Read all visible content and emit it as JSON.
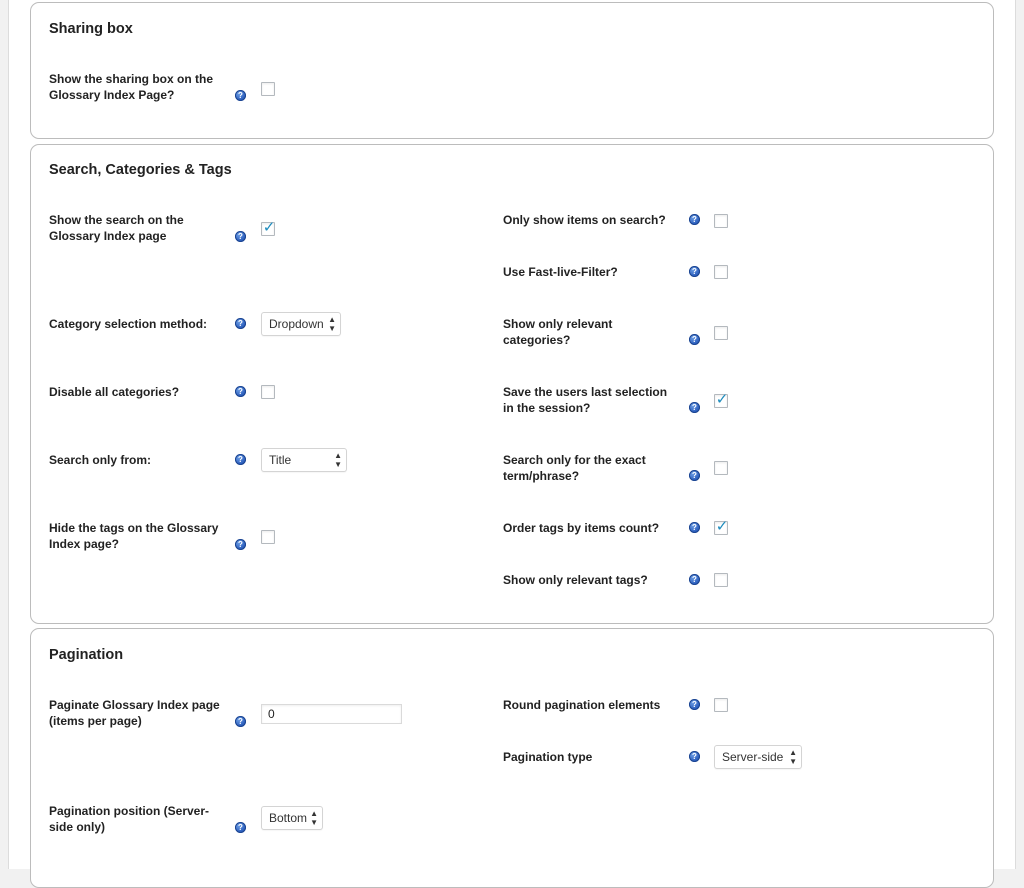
{
  "sharing_box": {
    "title": "Sharing box",
    "show_sharing_box": {
      "label_line1": "Show the sharing box on the",
      "label_line2": "Glossary Index Page?",
      "checked": false
    }
  },
  "search_section": {
    "title": "Search, Categories & Tags",
    "left": {
      "show_search": {
        "label_line1": "Show the search on the",
        "label_line2": "Glossary Index page",
        "checked": true
      },
      "category_method": {
        "label": "Category selection method:",
        "value": "Dropdown"
      },
      "disable_categories": {
        "label": "Disable all categories?",
        "checked": false
      },
      "search_only_from": {
        "label": "Search only from:",
        "value": "Title"
      },
      "hide_tags": {
        "label_line1": "Hide the tags on the Glossary",
        "label_line2": "Index page?",
        "checked": false
      }
    },
    "right": {
      "only_show_on_search": {
        "label": "Only show items on search?",
        "checked": false
      },
      "fast_live_filter": {
        "label": "Use Fast-live-Filter?",
        "checked": false
      },
      "relevant_categories": {
        "label_line1": "Show only relevant",
        "label_line2": "categories?",
        "checked": false
      },
      "save_last_selection": {
        "label_line1": "Save the users last selection",
        "label_line2": "in the session?",
        "checked": true
      },
      "exact_phrase": {
        "label_line1": "Search only for the exact",
        "label_line2": "term/phrase?",
        "checked": false
      },
      "order_tags": {
        "label": "Order tags by items count?",
        "checked": true
      },
      "relevant_tags": {
        "label": "Show only relevant tags?",
        "checked": false
      }
    }
  },
  "pagination": {
    "title": "Pagination",
    "items_per_page": {
      "label_line1": "Paginate Glossary Index page",
      "label_line2": "(items per page)",
      "value": "0"
    },
    "position": {
      "label_line1": "Pagination position (Server-",
      "label_line2": "side only)",
      "value": "Bottom"
    },
    "round_elements": {
      "label": "Round pagination elements",
      "checked": false
    },
    "type": {
      "label": "Pagination type",
      "value": "Server-side"
    }
  },
  "icons": {
    "help": "help-question-icon",
    "check": "checkmark-icon",
    "select_arrows": "updown-arrows-icon"
  },
  "colors": {
    "help_icon": "#2f62c0",
    "check": "#1e8cbe",
    "border": "#bcbcbc"
  },
  "glyphs": {
    "help": "?",
    "tick": "✓",
    "up": "▲",
    "down": "▼"
  }
}
